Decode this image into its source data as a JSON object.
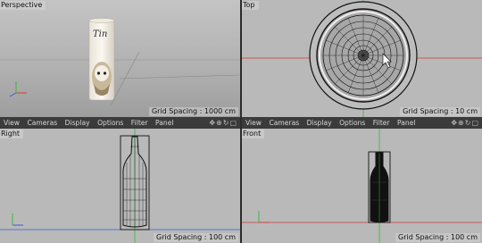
{
  "viewports": {
    "perspective": {
      "title": "Perspective",
      "grid_spacing": "Grid Spacing : 1000 cm"
    },
    "top": {
      "title": "Top",
      "grid_spacing": "Grid Spacing : 10 cm"
    },
    "right": {
      "title": "Right",
      "grid_spacing": "Grid Spacing : 100 cm"
    },
    "front": {
      "title": "Front",
      "grid_spacing": "Grid Spacing : 100 cm"
    }
  },
  "menus": {
    "bottom_left": [
      "View",
      "Cameras",
      "Display",
      "Options",
      "Filter",
      "Panel"
    ],
    "bottom_right": [
      "View",
      "Cameras",
      "Display",
      "Options",
      "Filter",
      "Panel"
    ]
  },
  "label_text": "Tin",
  "icons": [
    "move-icon",
    "zoom-icon",
    "rotate-icon",
    "maximize-icon"
  ],
  "colors": {
    "viewport_bg": "#b9b9b9",
    "menubar_bg": "#3b3b3b",
    "axis_x": "#d43a3a",
    "axis_y": "#3ab83a",
    "axis_z": "#3a5ad8"
  }
}
